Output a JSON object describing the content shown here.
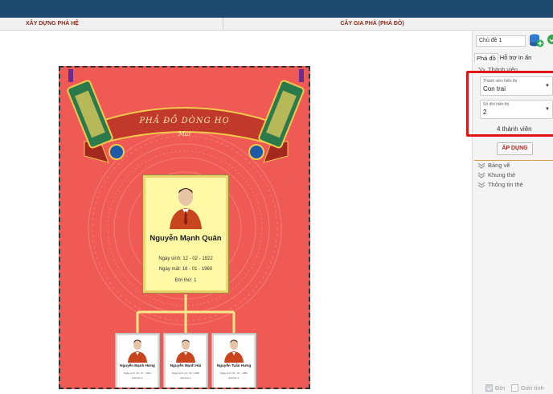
{
  "header": {
    "tab_left": "XÂY DỰNG PHẢ HỆ",
    "tab_right": "CÂY GIA PHẢ (PHẢ ĐỒ)"
  },
  "poster": {
    "title": "PHẢ ĐỒ DÒNG HỌ",
    "subtitle": "Mai",
    "root": {
      "name": "Nguyễn Mạnh Quân",
      "birth": "Ngày sinh: 12 - 02 - 1922",
      "death": "Ngày mất: 16 - 01 - 1960",
      "generation": "Đời thứ: 1"
    },
    "children": [
      {
        "name": "Nguyễn Mạnh Hưng",
        "info": "Ngày sinh: 16 - 07 - 1944",
        "generation": "Đời thứ 2"
      },
      {
        "name": "Nguyễn Mạnh Hải",
        "info": "Ngày sinh: 23 - 02 - 1948",
        "generation": "Đời thứ 2"
      },
      {
        "name": "Nguyễn Tuấn Hưng",
        "info": "Ngày sinh: 01 - 01 - 1950",
        "generation": "Đời thứ 2"
      }
    ]
  },
  "panel": {
    "topic": "Chủ đề 1",
    "tabs": [
      "Phả đồ",
      "Hỗ trợ in ấn"
    ],
    "section_members": "Thành viên",
    "member_field": {
      "label": "Thành viên hiển thị",
      "value": "Con trai"
    },
    "gen_field": {
      "label": "Số đời hiển thị",
      "value": "2"
    },
    "member_count": "4 thành viên",
    "apply_label": "ÁP DỤNG",
    "sections": [
      "Bảng vẽ",
      "Khung thẻ",
      "Thông tin thẻ"
    ],
    "footer": {
      "gen_label": "Đời",
      "gender_label": "Giới tính"
    }
  },
  "colors": {
    "topbar": "#1d4a6e",
    "poster_bg": "#ef5a55",
    "root_card": "#fff9a6",
    "highlight": "#e01414",
    "apply_text": "#b3231a"
  },
  "icons": [
    "database-add-icon",
    "add-circle-icon",
    "chevron-double-icon",
    "dropdown-caret-icon",
    "person-avatar-icon",
    "checkbox-icon"
  ]
}
